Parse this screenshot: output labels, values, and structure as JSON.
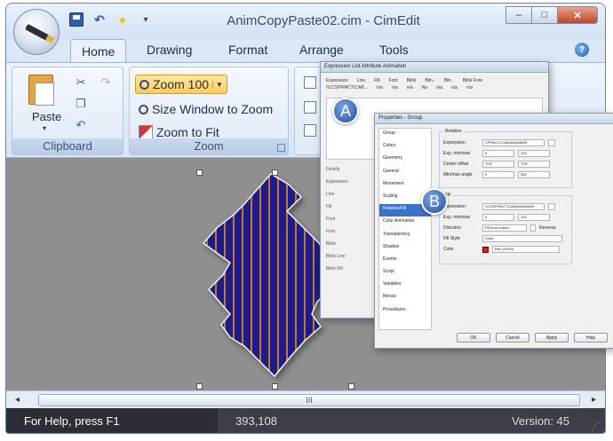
{
  "window": {
    "title": "AnimCopyPaste02.cim - CimEdit",
    "controls": {
      "minimize": "–",
      "maximize": "□",
      "close": "✕"
    }
  },
  "quick_access": {
    "more": "▾"
  },
  "tabs": [
    "Home",
    "Drawing",
    "Format",
    "Arrange",
    "Tools"
  ],
  "ribbon": {
    "clipboard": {
      "label": "Clipboard",
      "paste": "Paste",
      "paste_arrow": "▾"
    },
    "zoom": {
      "label": "Zoom",
      "zoom100": "Zoom 100",
      "size_window": "Size Window to Zoom",
      "zoom_fit": "Zoom to Fit"
    }
  },
  "callouts": {
    "a": "A",
    "b": "B"
  },
  "dialog_expression": {
    "title": "Expression List Attribute Animation",
    "columns": [
      "Expression",
      "Line",
      "Fill",
      "Font",
      "Blink",
      "Blin..",
      "Blin..",
      "Blink Fore"
    ],
    "row": [
      "\\\\CCSP\\PACT\\CAB...",
      "n/a",
      "n/a",
      "n/a",
      "No",
      "n/a",
      "n/a",
      "n/a"
    ],
    "side_items": [
      "Details",
      "Expression",
      "Line",
      "Fill",
      "Font",
      "Font",
      "Blink",
      "Blink Line",
      "Blink Fill"
    ]
  },
  "dialog_properties": {
    "title": "Properties - Group",
    "categories": [
      "Group",
      "Colors",
      "Geometry",
      "General",
      "Movement",
      "Scaling",
      "Rotation/Fill",
      "Color Animation",
      "Transparency",
      "Shadow",
      "Events",
      "Script",
      "Variables",
      "Menus",
      "Procedures"
    ],
    "selected_category": "Rotation/Fill",
    "rotation": {
      "title": "Rotation",
      "expression_label": "Expression",
      "expression_value": "CP\\PACT\\CAB\\AVA\\AMAR",
      "exp_minmax_label": "Exp. min/max",
      "exp_min": "0",
      "exp_max": "100",
      "center_offset_label": "Center offset",
      "center_x": "TOP",
      "center_y": "TOP",
      "minmax_angle_label": "Min/max angle",
      "angle_min": "0",
      "angle_max": "360"
    },
    "fill": {
      "title": "Fill",
      "expression_label": "Expression",
      "expression_value": "\\\\CCSP\\PACT\\CAB\\AVA\\AMAR",
      "exp_minmax_label": "Exp. min/max",
      "exp_min": "0",
      "exp_max": "100",
      "direction_label": "Direction",
      "direction_value": "Fill from bottom",
      "reverse_label": "Reverse",
      "fill_style_label": "Fill Style",
      "fill_style_value": "Solid",
      "color_label": "Color",
      "color_value": "Red (100%)",
      "color_hex": "#e02020"
    },
    "buttons": [
      "OK",
      "Cancel",
      "Apply",
      "Help"
    ]
  },
  "scrollbar": {
    "left_arrow": "◂",
    "right_arrow": "▸",
    "grip": "III"
  },
  "status": {
    "help": "For Help, press F1",
    "coords": "393,108",
    "version": "Version: 45"
  },
  "colors": {
    "shape_fill": "#1a1a8c",
    "shape_stripe": "#c8762a",
    "canvas": "#8f8f8f"
  }
}
